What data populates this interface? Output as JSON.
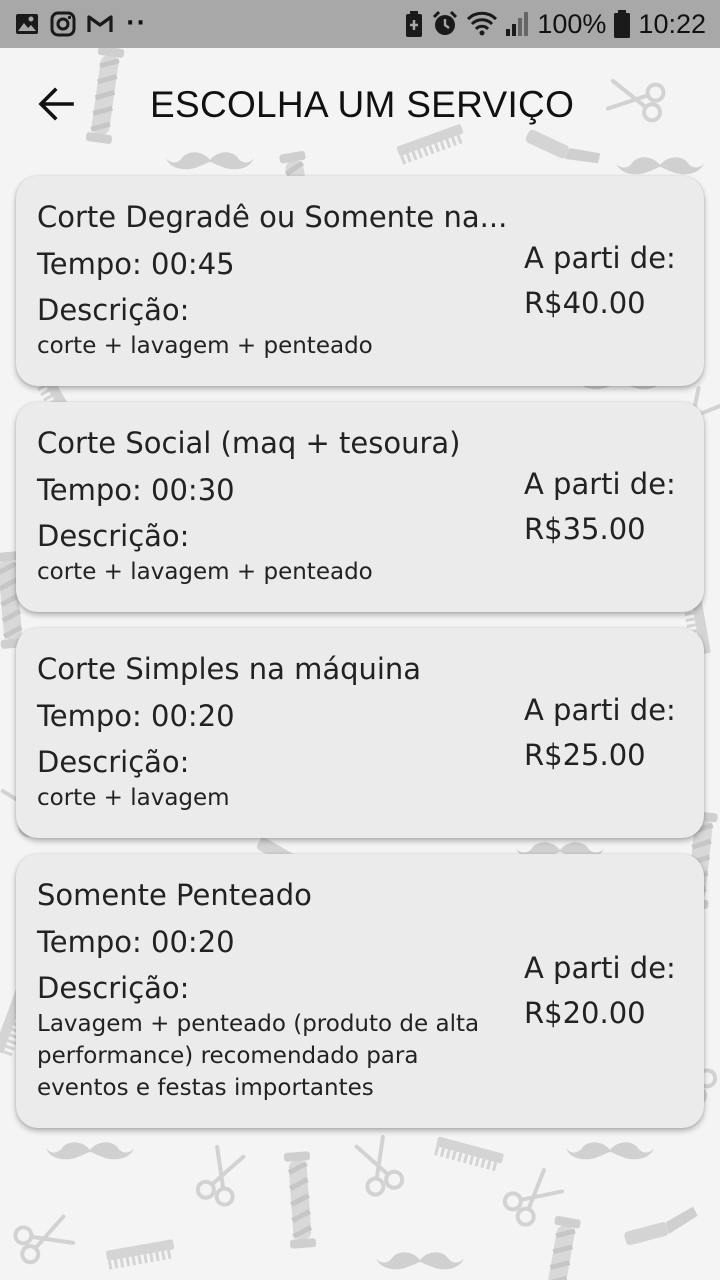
{
  "status_bar": {
    "battery_text": "100%",
    "time": "10:22",
    "dots": "··",
    "left_icons": [
      "image-icon",
      "instagram-icon",
      "gmail-icon"
    ],
    "right_icons": [
      "battery-saver-icon",
      "alarm-icon",
      "wifi-icon",
      "signal-icon",
      "battery-icon"
    ]
  },
  "header": {
    "back_icon": "arrow-left-icon",
    "title": "ESCOLHA UM SERVIÇO"
  },
  "services": [
    {
      "name": "Corte Degradê ou Somente na...",
      "tempo": "Tempo: 00:45",
      "descricao_label": "Descrição:",
      "descricao": "corte + lavagem + penteado",
      "price_label": "A parti de:",
      "price": "R$40.00"
    },
    {
      "name": "Corte Social (maq + tesoura)",
      "tempo": "Tempo: 00:30",
      "descricao_label": "Descrição:",
      "descricao": "corte + lavagem + penteado",
      "price_label": "A parti de:",
      "price": "R$35.00"
    },
    {
      "name": "Corte Simples na máquina",
      "tempo": "Tempo: 00:20",
      "descricao_label": "Descrição:",
      "descricao": "corte + lavagem",
      "price_label": "A parti de:",
      "price": "R$25.00"
    },
    {
      "name": "Somente Penteado",
      "tempo": "Tempo: 00:20",
      "descricao_label": "Descrição:",
      "descricao": "Lavagem + penteado (produto de alta performance) recomendado para eventos e festas importantes",
      "price_label": "A parti de:",
      "price": "R$20.00"
    }
  ],
  "colors": {
    "status_bar_bg": "#a8a8a8",
    "card_bg": "#ebebeb",
    "page_bg": "#f4f4f4",
    "text": "#222222"
  }
}
